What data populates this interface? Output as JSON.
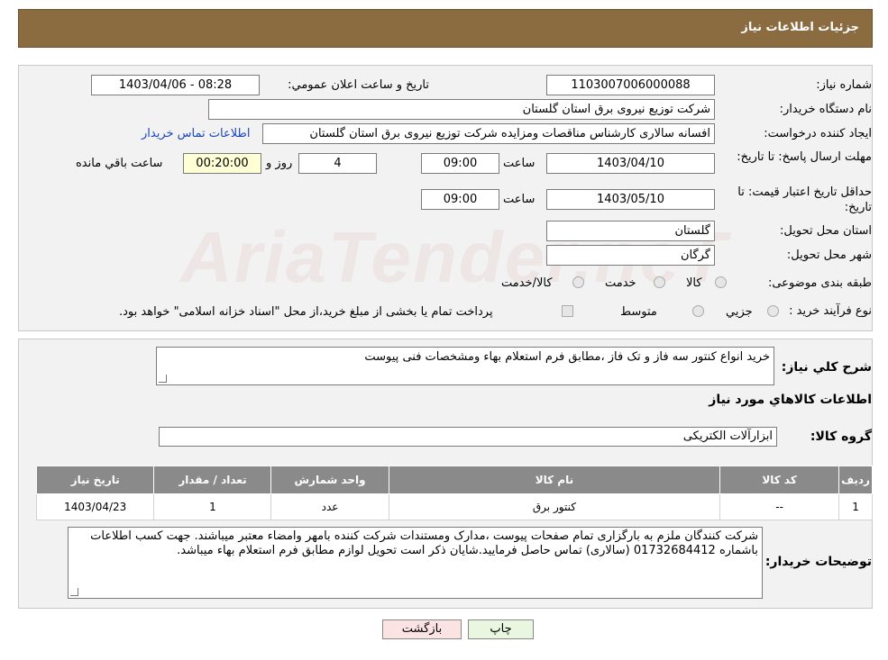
{
  "header": {
    "title": "جزئيات اطلاعات نياز"
  },
  "form": {
    "need_number_label": "شماره نياز:",
    "need_number": "1103007006000088",
    "announce_label": "تاريخ و ساعت اعلان عمومي:",
    "announce_value": "1403/04/06 - 08:28",
    "buyer_label": "نام دستگاه خريدار:",
    "buyer_value": "شركت توزيع نيروی برق استان گلستان",
    "creator_label": "ايجاد كننده درخواست:",
    "creator_value": "افسانه سالاری كارشناس مناقصات ومزايده شركت توزيع نيروی برق استان گلستان",
    "contact_link": "اطلاعات تماس خريدار",
    "reply_deadline_label": "مهلت ارسال پاسخ: تا تاريخ:",
    "reply_date": "1403/04/10",
    "time_label": "ساعت",
    "reply_time": "09:00",
    "days_value": "4",
    "days_label": "روز و",
    "remaining_value": "00:20:00",
    "remaining_label": "ساعت باقي مانده",
    "validity_label": "حداقل تاريخ اعتبار قيمت: تا تاريخ:",
    "validity_date": "1403/05/10",
    "validity_time": "09:00",
    "province_label": "استان محل تحويل:",
    "province_value": "گلستان",
    "city_label": "شهر محل تحويل:",
    "city_value": "گرگان",
    "category_label": "طبقه بندی موضوعی:",
    "category_options": [
      "كالا",
      "خدمت",
      "كالا/خدمت"
    ],
    "process_label": "نوع فرآيند خريد :",
    "process_options": [
      "جزيي",
      "متوسط"
    ],
    "payment_note": "پرداخت تمام يا بخشی از مبلغ خريد،از محل \"اسناد خزانه اسلامی\" خواهد بود."
  },
  "details": {
    "summary_label": "شرح كلي نياز:",
    "summary_value": "خريد انواع كنتور سه فاز و تک فاز ،مطابق فرم استعلام بهاء ومشخصات فنی پيوست",
    "goods_info_title": "اطلاعات كالاهاي مورد نياز",
    "group_label": "گروه كالا:",
    "group_value": "ابزارآلات الكتريكی",
    "table": {
      "headers": [
        "رديف",
        "كد كالا",
        "نام كالا",
        "واحد شمارش",
        "تعداد / مقدار",
        "تاريخ نياز"
      ],
      "rows": [
        [
          "1",
          "--",
          "كنتور برق",
          "عدد",
          "1",
          "1403/04/23"
        ]
      ]
    },
    "buyer_notes_label": "توضيحات خريدار:",
    "buyer_notes_value": "شركت كنندگان ملزم به بارگزاری تمام صفحات پيوست ،مدارک ومستندات شركت كننده بامهر وامضاء معتبر ميباشند. جهت كسب اطلاعات باشماره 01732684412 (سالاری) تماس حاصل فرماييد.شايان ذكر است تحويل لوازم مطابق فرم استعلام بهاء ميباشد."
  },
  "buttons": {
    "print": "چاپ",
    "back": "بازگشت"
  },
  "colors": {
    "header_bg": "#8b6b40",
    "table_header_bg": "#8a8a8a",
    "link": "#1a47c5",
    "back_button_bg": "#fbe3e4"
  }
}
